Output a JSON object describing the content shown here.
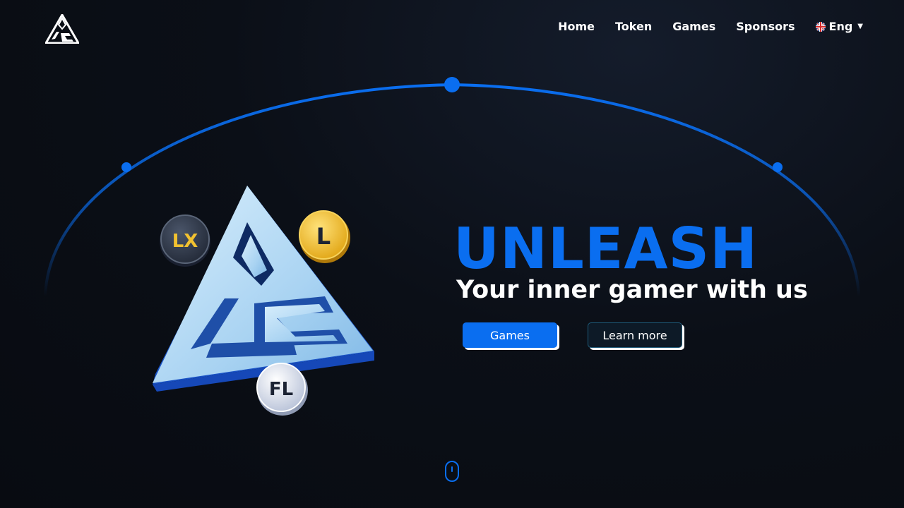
{
  "nav": {
    "items": [
      {
        "label": "Home"
      },
      {
        "label": "Token"
      },
      {
        "label": "Games"
      },
      {
        "label": "Sponsors"
      }
    ],
    "language": "Eng"
  },
  "hero": {
    "headline": "UNLEASH",
    "subheadline": "Your inner gamer with us",
    "primary_button": "Games",
    "secondary_button": "Learn more",
    "coins": [
      {
        "label": "LX"
      },
      {
        "label": "L"
      },
      {
        "label": "FL"
      }
    ]
  },
  "colors": {
    "accent": "#0a6ef0",
    "background": "#0b0f17",
    "secondary_button_bg": "#0d1a27"
  },
  "icons": {
    "logo": "lg-triangle-logo",
    "language_flag": "uk-flag-icon",
    "scroll": "mouse-scroll-icon"
  }
}
